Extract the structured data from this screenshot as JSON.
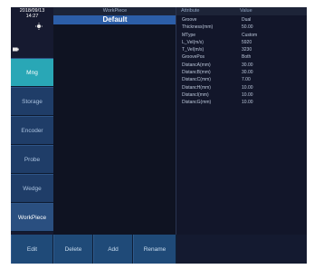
{
  "status": {
    "date": "2018/09/13",
    "time": "14:27"
  },
  "sidebar": {
    "items": [
      {
        "label": "Mng"
      },
      {
        "label": "Storage"
      },
      {
        "label": "Encoder"
      },
      {
        "label": "Probe"
      },
      {
        "label": "Wedge"
      },
      {
        "label": "WorkPiece"
      }
    ]
  },
  "workpiece_list": {
    "header": "WorkPiece",
    "selected": "Default"
  },
  "attributes": {
    "header_attr": "Attribute",
    "header_value": "Value",
    "rows": [
      {
        "k": "Groove",
        "v": "Dual"
      },
      {
        "k": "Thickness(mm)",
        "v": "50.00"
      },
      {
        "k": "MType",
        "v": "Custom"
      },
      {
        "k": "L_Vel(m/s)",
        "v": "5920"
      },
      {
        "k": "T_Vel(m/s)",
        "v": "3230"
      },
      {
        "k": "GroovePos",
        "v": "Both"
      },
      {
        "k": "DistancA(mm)",
        "v": "30.00"
      },
      {
        "k": "DistancB(mm)",
        "v": "30.00"
      },
      {
        "k": "DistancC(mm)",
        "v": "7.00"
      },
      {
        "k": "DistancH(mm)",
        "v": "10.00"
      },
      {
        "k": "DistancI(mm)",
        "v": "10.00"
      },
      {
        "k": "DistancG(mm)",
        "v": "10.00"
      }
    ]
  },
  "bottom": {
    "edit": "Edit",
    "delete": "Delete",
    "add": "Add",
    "rename": "Rename"
  },
  "colors": {
    "active_tab": "#29a7b6",
    "selected_row": "#2c5ea8",
    "background": "#12162a"
  }
}
